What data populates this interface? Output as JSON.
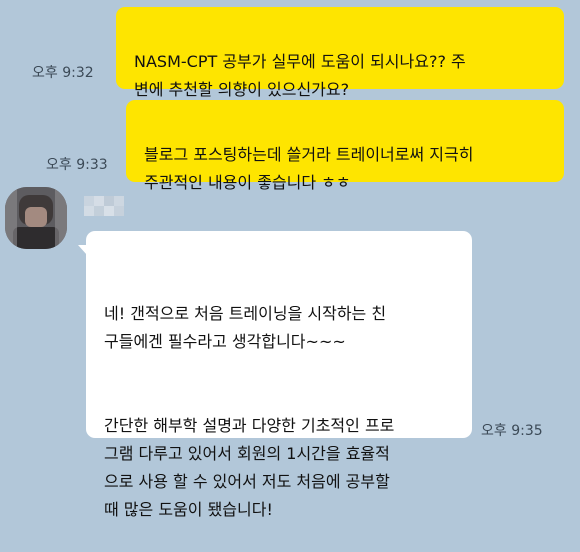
{
  "messages": [
    {
      "direction": "sent",
      "text": "NASM-CPT 공부가 실무에 도움이 되시나요??  주\n변에 추천할 의향이 있으신가요?",
      "time": "오후 9:32"
    },
    {
      "direction": "sent",
      "text": "블로그 포스팅하는데 쓸거라 트레이너로써 지극히\n주관적인 내용이 좋습니다 ㅎㅎ",
      "time": "오후 9:33"
    },
    {
      "direction": "received",
      "sender_name": "",
      "paragraphs": [
        "네! 갠적으로 처음 트레이닝을 시작하는 친\n구들에겐 필수라고 생각합니다~~~",
        "간단한 해부학 설명과 다양한 기초적인 프로\n그램 다루고 있어서 회원의 1시간을 효율적\n으로 사용 할 수 있어서 저도 처음에 공부할\n때 많은 도움이 됐습니다!"
      ],
      "time": "오후 9:35"
    }
  ],
  "colors": {
    "background": "#b2c7d9",
    "sent_bubble": "#fee500",
    "received_bubble": "#ffffff",
    "timestamp": "#3c4a57"
  },
  "icons": {
    "avatar": "blurred-profile-photo"
  }
}
